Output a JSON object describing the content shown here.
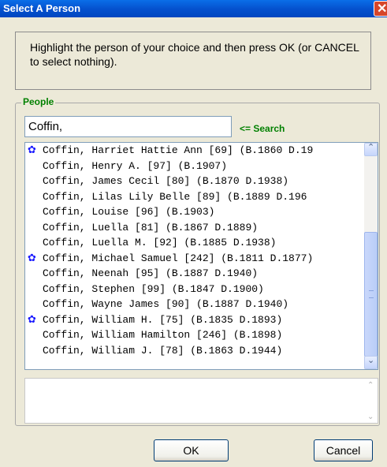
{
  "window": {
    "title": "Select A Person",
    "close_glyph": "✕"
  },
  "instructions": "Highlight the person of your choice and then press OK (or CANCEL to select nothing).",
  "people_group": {
    "label": "People",
    "search_value": "Coffin,",
    "search_hint": "<= Search"
  },
  "people_list": [
    {
      "text": "Coffin, Harriet Hattie Ann [69] (B.1860 D.19",
      "starred": true
    },
    {
      "text": "Coffin, Henry A. [97] (B.1907)",
      "starred": false
    },
    {
      "text": "Coffin, James Cecil [80] (B.1870 D.1938)",
      "starred": false
    },
    {
      "text": "Coffin, Lilas Lily Belle [89] (B.1889 D.196",
      "starred": false
    },
    {
      "text": "Coffin, Louise [96] (B.1903)",
      "starred": false
    },
    {
      "text": "Coffin, Luella [81] (B.1867 D.1889)",
      "starred": false
    },
    {
      "text": "Coffin, Luella M. [92] (B.1885 D.1938)",
      "starred": false
    },
    {
      "text": "Coffin, Michael Samuel [242] (B.1811 D.1877)",
      "starred": true
    },
    {
      "text": "Coffin, Neenah [95] (B.1887 D.1940)",
      "starred": false
    },
    {
      "text": "Coffin, Stephen [99] (B.1847 D.1900)",
      "starred": false
    },
    {
      "text": "Coffin, Wayne James [90] (B.1887 D.1940)",
      "starred": false
    },
    {
      "text": "Coffin, William H. [75] (B.1835 D.1893)",
      "starred": true
    },
    {
      "text": "Coffin, William Hamilton [246] (B.1898)",
      "starred": false
    },
    {
      "text": "Coffin, William J. [78] (B.1863 D.1944)",
      "starred": false
    }
  ],
  "icons": {
    "star": "star-icon",
    "scroll_up": "chevron-up-icon",
    "scroll_down": "chevron-down-icon"
  },
  "star_glyph": "✿",
  "buttons": {
    "ok": "OK",
    "cancel": "Cancel"
  },
  "colors": {
    "title_bar": "#0552cf",
    "group_label": "#008000",
    "star": "#1a1aff",
    "window_bg": "#ece9d8"
  }
}
